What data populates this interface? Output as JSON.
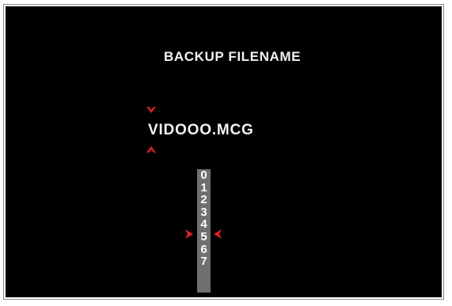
{
  "screen": {
    "title": "BACKUP FILENAME",
    "filename": "VIDOOO.MCG"
  },
  "digit_picker": {
    "digits": [
      "0",
      "1",
      "2",
      "3",
      "4",
      "5",
      "6",
      "7"
    ],
    "selected": "4"
  },
  "colors": {
    "background": "#000000",
    "text": "#f2f2f2",
    "accent_red": "#e0202a",
    "picker_bg": "#6f6f6f"
  },
  "icons": {
    "caret_up": "chevron-down-icon",
    "caret_down": "chevron-up-icon",
    "selection_left": "arrow-right-icon",
    "selection_right": "arrow-left-icon"
  }
}
